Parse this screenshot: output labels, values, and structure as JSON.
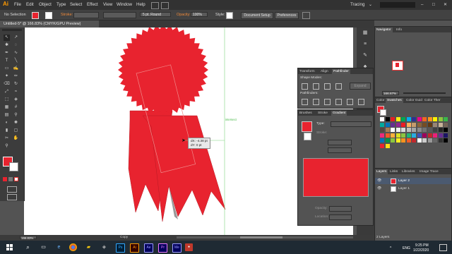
{
  "app": {
    "logo": "Ai",
    "workspace": "Tracing"
  },
  "menu": [
    "File",
    "Edit",
    "Object",
    "Type",
    "Select",
    "Effect",
    "View",
    "Window",
    "Help"
  ],
  "options": {
    "selection": "No Selection",
    "stroke_label": "Stroke:",
    "brush": "5 pt. Round",
    "opacity_label": "Opacity:",
    "opacity_value": "100%",
    "style_label": "Style:",
    "document_setup": "Document Setup",
    "preferences": "Preferences"
  },
  "document_tab": "Untitled-5* @ 166.83% (CMYK/GPU Preview)",
  "canvas": {
    "guide_label": "intersect",
    "tooltip_dx": "dX: -4.38 pt",
    "tooltip_dy": "dY: 0 pt",
    "ribbon_color": "#e8232f",
    "ribbon_shadow": "#c81a25"
  },
  "navigator": {
    "tabs": [
      "Navigator",
      "Info"
    ],
    "zoom": "166.67%"
  },
  "pathfinder": {
    "tabs": [
      "Transform",
      "Align",
      "Pathfinder"
    ],
    "shape_modes": "Shape Modes:",
    "expand": "Expand",
    "pathfinders": "Pathfinders:"
  },
  "gradient": {
    "tabs": [
      "Brushes",
      "Stroke",
      "Gradient"
    ],
    "type_label": "Type:",
    "stroke_label": "Stroke:",
    "opacity_label": "Opacity:",
    "location_label": "Location:"
  },
  "swatches": {
    "tabs": [
      "Color",
      "Swatches",
      "Color Guid",
      "Color Ther"
    ],
    "colors": [
      "#ffffff",
      "#000000",
      "#e31e24",
      "#f7ec13",
      "#00a651",
      "#00adef",
      "#2e3192",
      "#ec008c",
      "#f26522",
      "#f7941d",
      "#fff200",
      "#8dc63f",
      "#39b54a",
      "#00a99d",
      "#0072bc",
      "#662d91",
      "#92278f",
      "#ed1c24",
      "#fbaf5d",
      "#c69c6d",
      "#8c6239",
      "#754c24",
      "#603913",
      "#998675",
      "#c7b299",
      "#736357",
      "#534741",
      "#a67c52",
      "#ffffff",
      "#f2f2f2",
      "#d9d9d9",
      "#bfbfbf",
      "#a6a6a6",
      "#8c8c8c",
      "#737373",
      "#595959",
      "#404040",
      "#262626",
      "#000000",
      "#ee2a7b",
      "#f15a24",
      "#fbb03b",
      "#d9e021",
      "#8cc63f",
      "#22b573",
      "#29abe2",
      "#3f51b5",
      "#9e005d",
      "#c1272d",
      "#ed1e79",
      "#662d91",
      "#1b1464",
      "#0071bc",
      "#009245",
      "#8cc63f",
      "#fcee21",
      "#f7931e",
      "#f15a24",
      "#c1272d",
      "#ffffff",
      "#cccccc",
      "#999999",
      "#666666",
      "#333333",
      "#000000",
      "#e8232f",
      "#ffde17"
    ]
  },
  "layers": {
    "tabs": [
      "Layers",
      "Links",
      "Libraries",
      "Image Trace"
    ],
    "items": [
      {
        "name": "Layer 2",
        "color": "#e8232f"
      },
      {
        "name": "Layer 1",
        "color": "#ffffff"
      }
    ],
    "count": "2 Layers"
  },
  "status": {
    "zoom": "166.83%",
    "tool": "Copy"
  },
  "taskbar": {
    "lang": "ENG",
    "time": "9:25 PM",
    "date": "1/22/2020",
    "apps": [
      {
        "label": "Ps",
        "color": "#001e36",
        "fg": "#31a8ff"
      },
      {
        "label": "Ai",
        "color": "#330000",
        "fg": "#ff9a00"
      },
      {
        "label": "Ae",
        "color": "#00005b",
        "fg": "#9999ff"
      },
      {
        "label": "Pr",
        "color": "#00005b",
        "fg": "#ea77ff"
      },
      {
        "label": "Me",
        "color": "#00005b",
        "fg": "#9999ff"
      }
    ]
  }
}
